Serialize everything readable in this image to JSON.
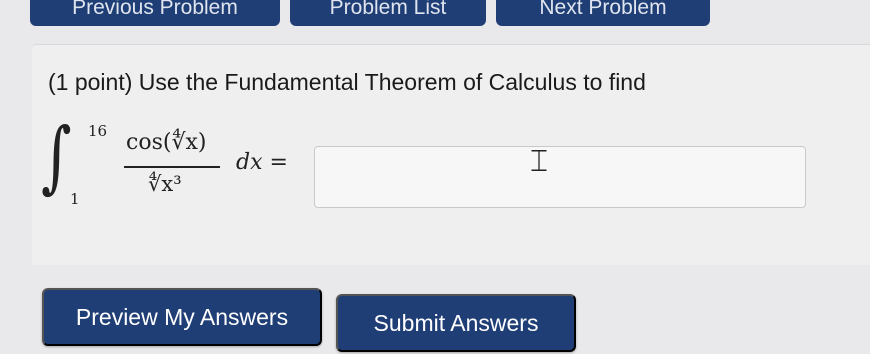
{
  "nav": {
    "prev_label": "Previous Problem",
    "list_label": "Problem List",
    "next_label": "Next Problem"
  },
  "problem": {
    "statement": "(1 point) Use the Fundamental Theorem of Calculus to find",
    "upper_limit": "16",
    "lower_limit": "1",
    "numerator": "cos(∜x)",
    "denominator": "∜x³",
    "dx_equals": "dx ="
  },
  "answer": {
    "value": "",
    "placeholder": ""
  },
  "actions": {
    "preview_label": "Preview My Answers",
    "submit_label": "Submit Answers"
  },
  "colors": {
    "button_bg": "#1f3e75",
    "button_text": "#ffffff"
  }
}
